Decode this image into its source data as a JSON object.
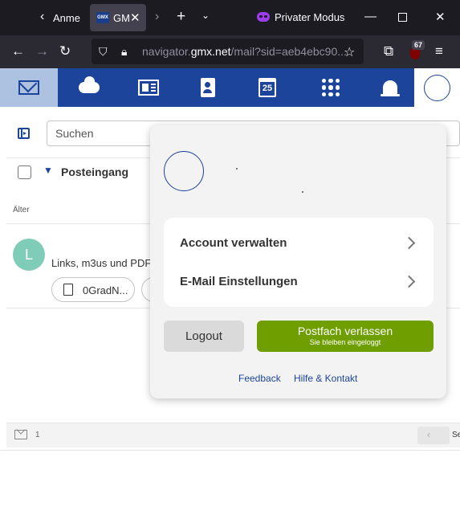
{
  "browser": {
    "prev_tab_label": "Anmel",
    "active_tab": {
      "favicon_text": "GMX",
      "label": "GM"
    },
    "private_mode_label": "Privater Modus",
    "url": {
      "host_prefix": "navigator.",
      "host_domain": "gmx.net",
      "path": "/mail?sid=aeb4ebc90..."
    },
    "extension_badge": "67"
  },
  "app_nav": {
    "calendar_day": "25"
  },
  "mailbox": {
    "search_placeholder": "Suchen",
    "folder_name": "Posteingang",
    "group_label": "Älter",
    "message": {
      "avatar_letter": "L",
      "subject": "Links, m3us und PDF",
      "attachment_name": "0GradN..."
    },
    "footer_count": "1",
    "footer_truncated": "Se"
  },
  "account_popup": {
    "items": [
      {
        "label": "Account verwalten"
      },
      {
        "label": "E-Mail Einstellungen"
      }
    ],
    "logout_label": "Logout",
    "leave_label": "Postfach verlassen",
    "leave_sublabel": "Sie bleiben eingeloggt",
    "links": {
      "feedback": "Feedback",
      "help": "Hilfe & Kontakt"
    }
  },
  "colors": {
    "brand_blue": "#1c449b",
    "active_nav": "#adc1e1",
    "leave_green": "#6e9e00",
    "private_purple": "#9e3cf0"
  }
}
